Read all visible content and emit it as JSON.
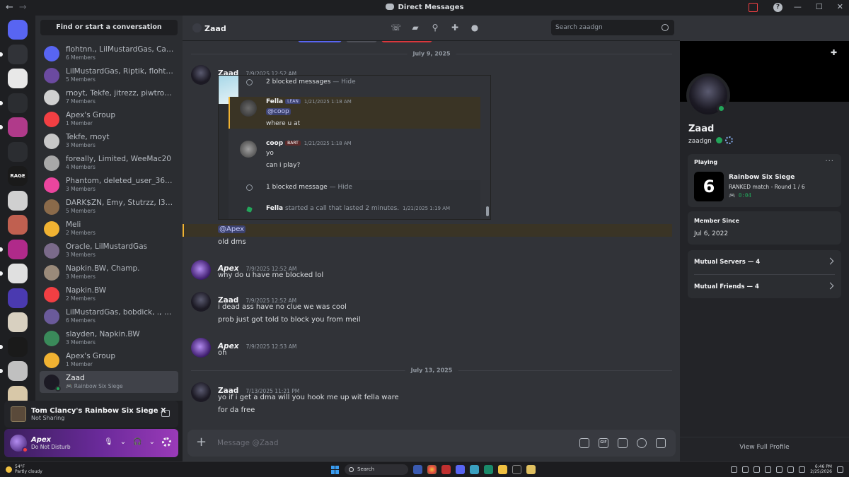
{
  "window": {
    "title": "Direct Messages",
    "nav_back": "←",
    "nav_forward": "→",
    "minimize": "—",
    "maximize": "☐",
    "close": "✕",
    "help": "?"
  },
  "sidebar": {
    "search_label": "Find or start a conversation",
    "dms": [
      {
        "name": "flohtnn., LilMustardGas, Cash...",
        "sub": "6 Members",
        "color": "#5865f2"
      },
      {
        "name": "LilMustardGas, Riptik, flohtn...",
        "sub": "5 Members",
        "color": "#6b4aa0"
      },
      {
        "name": "rnoyt, Tekfe, jitrezz, piwtrock...",
        "sub": "7 Members",
        "color": "#d0d0d0"
      },
      {
        "name": "Apex's Group",
        "sub": "1 Member",
        "color": "#f23f43"
      },
      {
        "name": "Tekfe, rnoyt",
        "sub": "3 Members",
        "color": "#c8c8c8"
      },
      {
        "name": "foreally, Limited, WeeMac20",
        "sub": "4 Members",
        "color": "#a8a8a8"
      },
      {
        "name": "Phantom, deleted_user_369b...",
        "sub": "3 Members",
        "color": "#eb459e"
      },
      {
        "name": "DARK$ZN, Emy, Stutrzz, l3an...",
        "sub": "5 Members",
        "color": "#8a6a4a"
      },
      {
        "name": "Meli",
        "sub": "2 Members",
        "color": "#f0b232"
      },
      {
        "name": "Oracle, LilMustardGas",
        "sub": "3 Members",
        "color": "#7a6a8a"
      },
      {
        "name": "Napkin.BW, Champ.",
        "sub": "3 Members",
        "color": "#9a8a7a"
      },
      {
        "name": "Napkin.BW",
        "sub": "2 Members",
        "color": "#f23f43"
      },
      {
        "name": "LilMustardGas, bobdick, ., Gu...",
        "sub": "6 Members",
        "color": "#6a5a9a"
      },
      {
        "name": "slayden, Napkin.BW",
        "sub": "3 Members",
        "color": "#3a8a5a"
      },
      {
        "name": "Apex's Group",
        "sub": "1 Member",
        "color": "#f0b232"
      },
      {
        "name": "Zaad",
        "sub": "Rainbow Six Siege",
        "color": "#1c1a24",
        "active": true
      }
    ],
    "activity": {
      "title": "Tom Clancy's Rainbow Six Siege X",
      "sub": "Not Sharing"
    },
    "user": {
      "name": "Apex",
      "status": "Do Not Disturb"
    }
  },
  "servers": [
    {
      "label": "",
      "color": "#5865f2"
    },
    {
      "label": "",
      "color": "#313338"
    },
    {
      "label": "",
      "color": "#e8e8e8"
    },
    {
      "label": "",
      "color": "#2b2d31"
    },
    {
      "label": "",
      "color": "#b03a8a"
    },
    {
      "label": "",
      "color": "#2b2d31"
    },
    {
      "label": "RAGE",
      "color": "#1a1a1a"
    },
    {
      "label": "",
      "color": "#d0d0d0"
    },
    {
      "label": "",
      "color": "#c06050"
    },
    {
      "label": "",
      "color": "#b02a8a"
    },
    {
      "label": "",
      "color": "#e0e0e0"
    },
    {
      "label": "",
      "color": "#4a3ab0"
    },
    {
      "label": "",
      "color": "#d8d0c0"
    },
    {
      "label": "",
      "color": "#1a1a1a"
    },
    {
      "label": "",
      "color": "#c0c0c0"
    },
    {
      "label": "",
      "color": "#d8c8a8"
    }
  ],
  "chat": {
    "channel_name": "Zaad",
    "search_placeholder": "Search zaadgn",
    "date_1": "July 9, 2025",
    "date_2": "July 13, 2025",
    "messages": [
      {
        "author": "Zaad",
        "time": "7/9/2025 12:52 AM"
      },
      {
        "author": "Apex",
        "time": "7/9/2025 12:52 AM",
        "line": "why do u have me blocked lol"
      },
      {
        "author": "Zaad",
        "time": "7/9/2025 12:52 AM",
        "line": "i dead ass have no clue we was cool",
        "line2": "prob just got told to block you from meil"
      },
      {
        "author": "Apex",
        "time": "7/9/2025 12:53 AM",
        "line": "oh"
      },
      {
        "author": "Zaad",
        "time": "7/13/2025 11:21 PM",
        "line": "yo if i get a dma will you hook me up wit fella ware",
        "line2": "for da free"
      }
    ],
    "mention": "@Apex",
    "mention_text": "old dms",
    "embed": {
      "blocked_1": "2 blocked messages",
      "hide_1": "— Hide",
      "fella_name": "Fella",
      "fella_tag": "LEAN",
      "fella_time": "1/21/2025 1:18 AM",
      "fella_mention": "@coop",
      "fella_text": "where u at",
      "coop_name": "coop",
      "coop_tag": "BART",
      "coop_time": "1/21/2025 1:18 AM",
      "coop_line1": "yo",
      "coop_line2": "can i play?",
      "blocked_2": "1 blocked message",
      "hide_2": "— Hide",
      "call_name": "Fella",
      "call_text": "started a call that lasted 2 minutes.",
      "call_time": "1/21/2025 1:19 AM"
    },
    "composer_placeholder": "Message @Zaad"
  },
  "profile": {
    "display_name": "Zaad",
    "username": "zaadgn",
    "playing_label": "Playing",
    "game_title": "Rainbow Six Siege",
    "game_detail": "RANKED match - Round 1 / 6",
    "game_timer": "0:04",
    "game_icon_glyph": "6",
    "member_since_label": "Member Since",
    "member_since": "Jul 6, 2022",
    "mutual_servers": "Mutual Servers — 4",
    "mutual_friends": "Mutual Friends — 4",
    "view_full": "View Full Profile"
  },
  "taskbar": {
    "temp": "54°F",
    "weather": "Partly cloudy",
    "search": "Search",
    "time": "6:46 PM",
    "date": "2/25/2026"
  }
}
